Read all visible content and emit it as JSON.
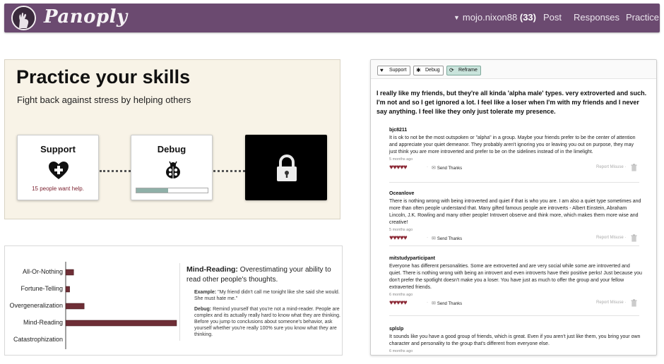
{
  "nav": {
    "brand": "Panoply",
    "user": "mojo.nixon88",
    "user_score": "(33)",
    "links": [
      "Post",
      "Responses",
      "Practice"
    ],
    "bar_color": "#6b4a70"
  },
  "practice": {
    "title": "Practice your skills",
    "subtitle": "Fight back against stress by helping others",
    "cards": {
      "support": {
        "title": "Support",
        "icon": "heart-plus-icon",
        "count_text": "15 people want help."
      },
      "debug": {
        "title": "Debug",
        "icon": "ladybug-icon",
        "progress": 0.45
      },
      "locked": {
        "icon": "lock-icon",
        "locked": true
      }
    }
  },
  "distortion": {
    "chart_data": {
      "type": "bar",
      "orientation": "horizontal",
      "categories": [
        "All-Or-Nothing",
        "Fortune-Telling",
        "Overgeneralization",
        "Mind-Reading",
        "Catastrophization"
      ],
      "values": [
        6,
        3,
        14,
        84,
        0
      ],
      "xlim": [
        0,
        84
      ],
      "grid": false,
      "bar_color": "#6e2e36"
    },
    "term": "Mind-Reading:",
    "definition": "Overestimating your ability to read other people's thoughts.",
    "example_label": "Example:",
    "example_text": "\"My friend didn't call me tonight like she said she would. She must hate me.\"",
    "debug_label": "Debug:",
    "debug_text": "Remind yourself that you're not a mind-reader. People are complex and its actually really hard to know what they are thinking. Before you jump to conclusions about someone's behavior, ask yourself whether you're really 100% sure you know what they are thinking."
  },
  "thread": {
    "tabs": [
      {
        "label": "Support",
        "icon": "heart-icon"
      },
      {
        "label": "Debug",
        "icon": "bug-icon"
      },
      {
        "label": "Reframe",
        "icon": "refresh-icon",
        "active": true
      }
    ],
    "post": "I really like my friends, but they're all kinda 'alpha male' types. very extroverted and such. I'm not and so I get ignored a lot. I feel like a loser when I'm with my friends and I never say anything. I feel like they only just tolerate my presence.",
    "send_thanks": "Send Thanks",
    "report": "Report Misuse",
    "replies": [
      {
        "author": "bjc8211",
        "text": "It is ok to not be the most outspoken or \"alpha\" in a group. Maybe your friends prefer to be the center of attention and appreciate your quiet demeanor. They probably aren't ignoring you or leaving you out on purpose, they may just think you are more introverted and prefer to be on the sidelines instead of in the limelight.",
        "when": "5 months ago",
        "rating": 5
      },
      {
        "author": "Oceanlove",
        "text": "There is nothing wrong with being introverted and quiet if that is who you are. I am also a quiet type sometimes and more than often people understand that. Many gifted famous people are introverts - Albert Einstein, Abraham Lincoln, J.K. Rowling and many other people! Introvert observe and think more, which makes them more wise and creative!",
        "when": "5 months ago",
        "rating": 5
      },
      {
        "author": "mitstudyparticipant",
        "text": "Everyone has different personalities. Some are extroverted and are very social while some are introverted and quiet. There is nothing wrong with being an introvert and even introverts have their positive perks! Just because you don't prefer the spotlight doesn't make you a loser. You have just as much to offer the group and your fellow extraverted friends.",
        "when": "6 months ago",
        "rating": 5
      },
      {
        "author": "splslp",
        "text": "It sounds like you have a good group of friends, which is great. Even if you aren't just like them, you bring your own character and personality to the group that's different from everyone else.",
        "when": "6 months ago",
        "rating": 5
      }
    ]
  }
}
